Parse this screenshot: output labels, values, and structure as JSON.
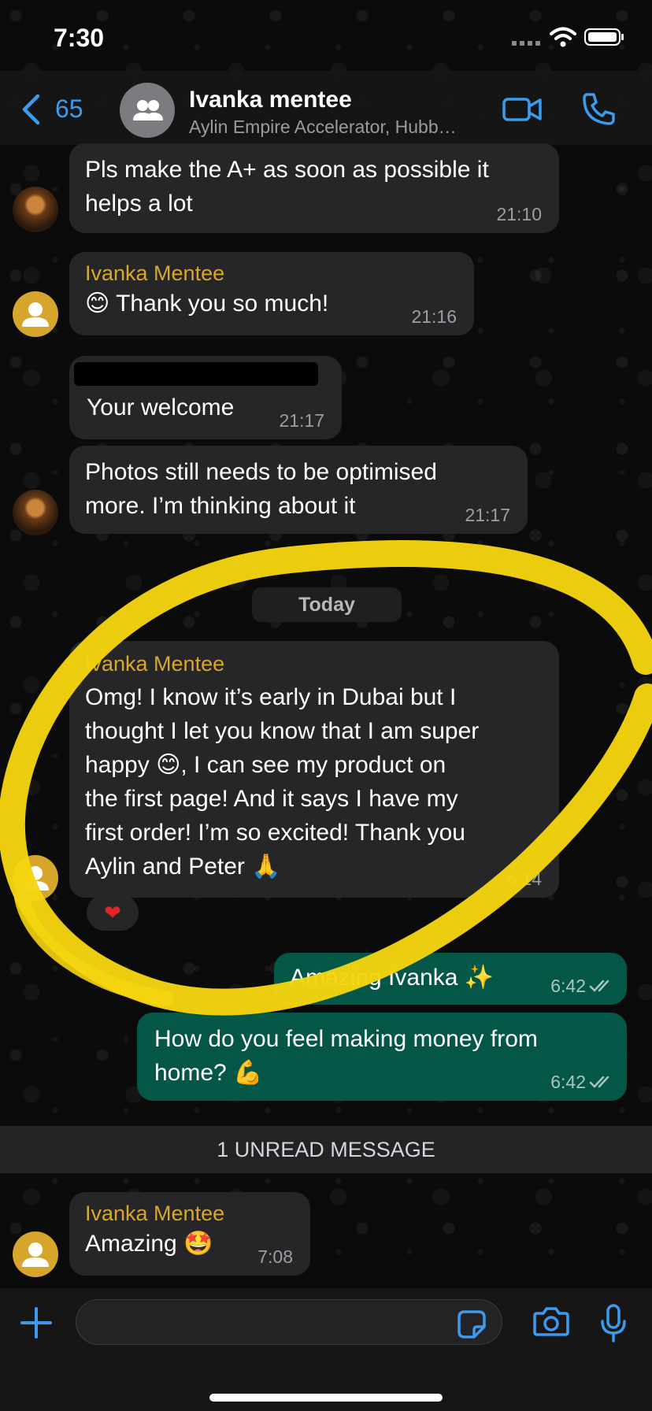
{
  "status_bar": {
    "time": "7:30"
  },
  "header": {
    "back_count": "65",
    "title": "Ivanka mentee",
    "subtitle": "Aylin Empire Accelerator, Hubb…"
  },
  "messages": [
    {
      "direction": "incoming",
      "sender": "",
      "text": "Pls make the A+ as soon as possible it\nhelps a lot",
      "time": "21:10"
    },
    {
      "direction": "incoming",
      "sender": "Ivanka Mentee",
      "emoji": "😊",
      "text": "Thank you so much!",
      "time": "21:16"
    },
    {
      "direction": "incoming",
      "sender": "",
      "text": "Your welcome",
      "time": "21:17"
    },
    {
      "direction": "incoming",
      "sender": "",
      "text": "Photos still needs to be optimised\nmore. I’m thinking about it",
      "time": "21:17"
    },
    {
      "direction": "incoming",
      "sender": "Ivanka Mentee",
      "text_before": "Omg! I know it’s early in Dubai but I\nthought I let you know that I am super\nhappy ",
      "emoji": "😊",
      "text_after": ", I can see my product on\nthe first page! And it says I have my\nfirst order! I’m so excited! Thank you\nAylin and Peter ",
      "emoji_end": "🙏",
      "time": "6:14",
      "reaction": "❤"
    },
    {
      "direction": "outgoing",
      "text": "Amazing Ivanka ",
      "emoji": "✨",
      "time": "6:42"
    },
    {
      "direction": "outgoing",
      "text": "How do you feel making money from\nhome? ",
      "emoji": "💪",
      "time": "6:42"
    },
    {
      "direction": "incoming",
      "sender": "Ivanka Mentee",
      "text": "Amazing ",
      "emoji": "🤩",
      "time": "7:08"
    }
  ],
  "day_separator": "Today",
  "unread_banner": "1 UNREAD MESSAGE",
  "input": {
    "value": ""
  },
  "colors": {
    "accent": "#3a9bef",
    "sender_name": "#d9a72a",
    "incoming_bubble": "#262628",
    "outgoing_bubble": "#045646",
    "highlight": "#f5d40f"
  },
  "icons": {
    "header": [
      "chevron-left-icon",
      "group-avatar-icon",
      "video-icon",
      "phone-icon"
    ],
    "input_bar": [
      "plus-icon",
      "sticker-icon",
      "camera-icon",
      "mic-icon"
    ],
    "message": [
      "double-check-icon"
    ]
  }
}
